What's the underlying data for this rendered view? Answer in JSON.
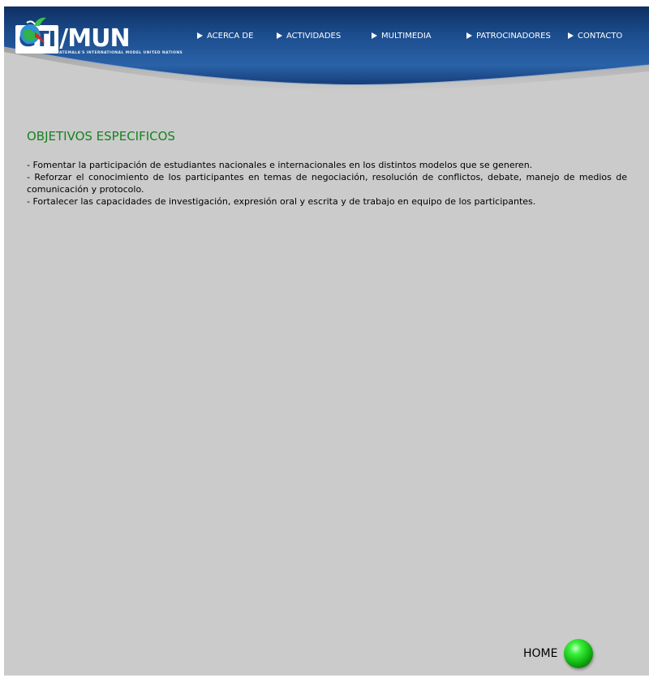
{
  "logo": {
    "part1": "GTI",
    "part2": "/MUN",
    "tagline": "GUATEMALA'S INTERNATIONAL MODEL UNITED NATIONS"
  },
  "nav": {
    "items": [
      {
        "label": "ACERCA DE"
      },
      {
        "label": "ACTIVIDADES"
      },
      {
        "label": "MULTIMEDIA"
      },
      {
        "label": "PATROCINADORES"
      },
      {
        "label": "CONTACTO"
      }
    ]
  },
  "main": {
    "title": "OBJETIVOS ESPECIFICOS",
    "objectives": [
      "- Fomentar la participación de estudiantes nacionales e internacionales en los distintos modelos que se generen.",
      "- Reforzar el conocimiento de los participantes en temas de negociación, resolución de conflictos, debate, manejo de medios de comunicación y protocolo.",
      "- Fortalecer las capacidades de investigación, expresión oral y escrita y de trabajo en equipo de los participantes."
    ]
  },
  "home": {
    "label": "HOME"
  },
  "colors": {
    "header_blue": "#1b4c8c",
    "title_green": "#17821e",
    "background_gray": "#cbcbcb",
    "home_ball_green": "#2ad82a"
  }
}
